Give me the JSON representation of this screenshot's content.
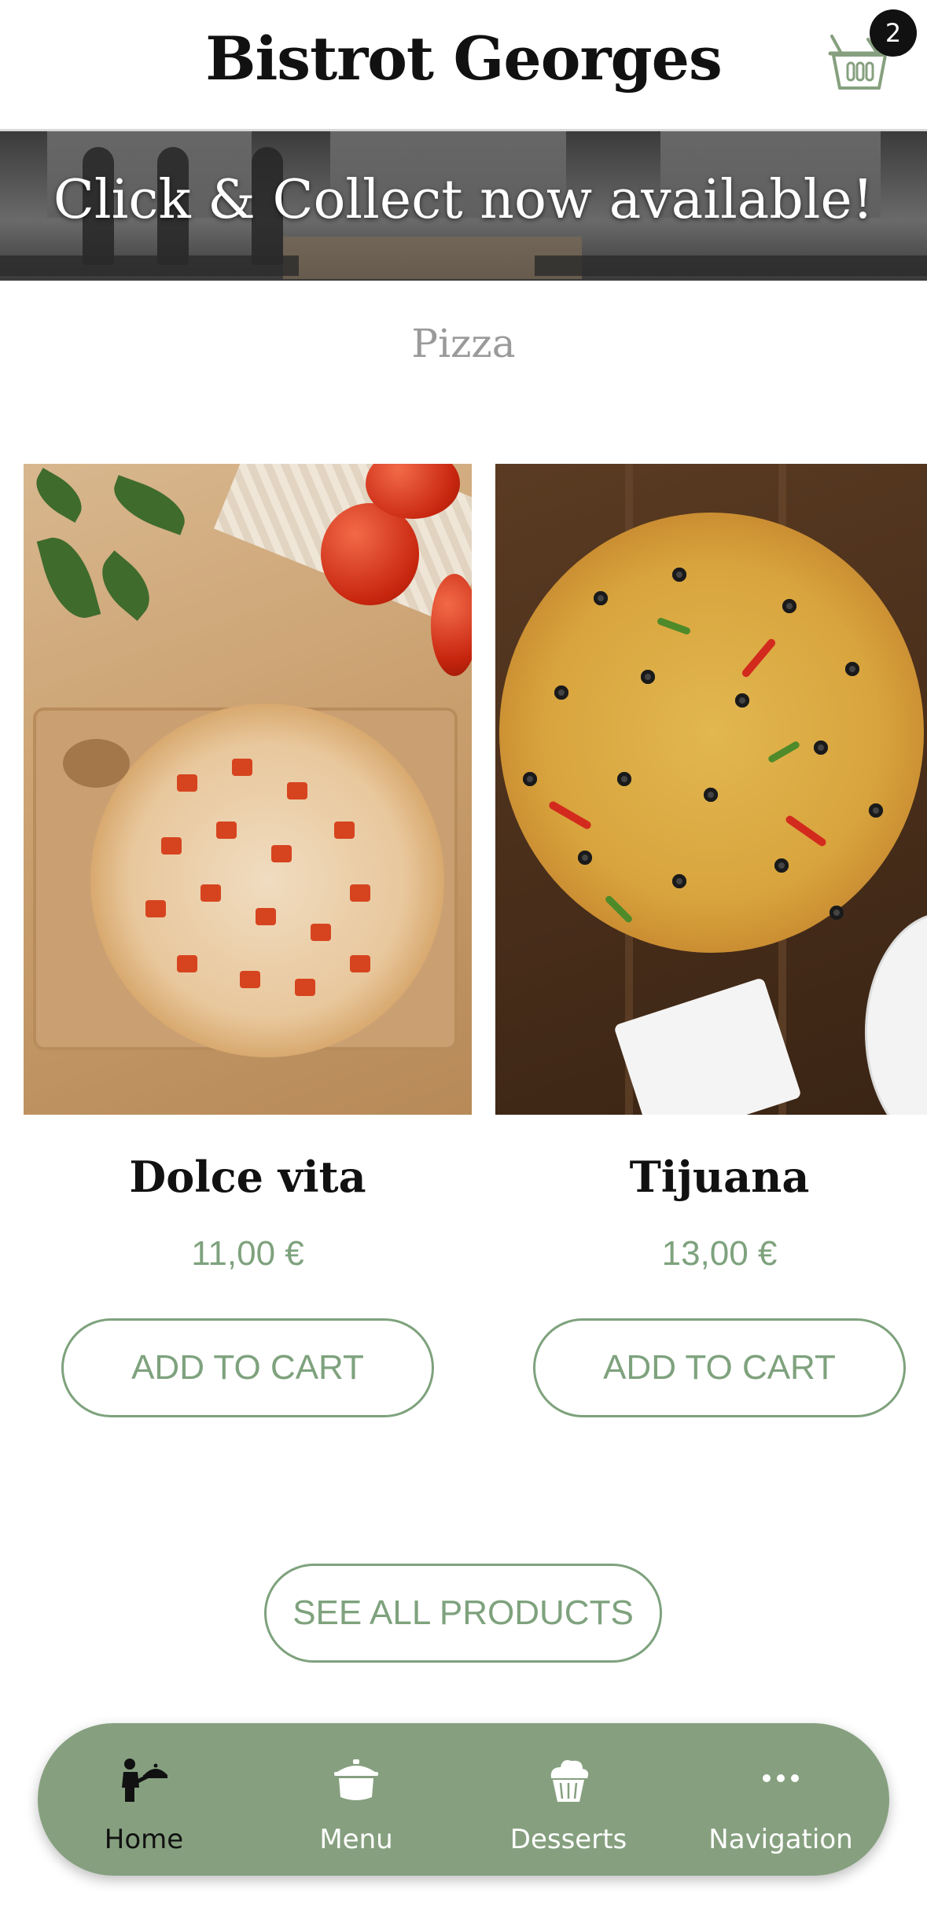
{
  "header": {
    "brand": "Bistrot Georges",
    "cart_count": "2"
  },
  "banner": {
    "text": "Click & Collect now available!"
  },
  "section": {
    "title": "Pizza"
  },
  "products": [
    {
      "name": "Dolce vita",
      "price": "11,00 €",
      "button": "ADD TO CART"
    },
    {
      "name": "Tijuana",
      "price": "13,00 €",
      "button": "ADD TO CART"
    }
  ],
  "see_all": "SEE ALL PRODUCTS",
  "bottom_nav": {
    "items": [
      {
        "label": "Home",
        "icon": "waiter-icon",
        "active": true
      },
      {
        "label": "Menu",
        "icon": "pot-icon"
      },
      {
        "label": "Desserts",
        "icon": "cupcake-icon"
      },
      {
        "label": "Navigation",
        "icon": "more-icon"
      }
    ]
  },
  "colors": {
    "accent": "#7ea27d",
    "nav_bg": "#86a07f",
    "text": "#111111"
  }
}
